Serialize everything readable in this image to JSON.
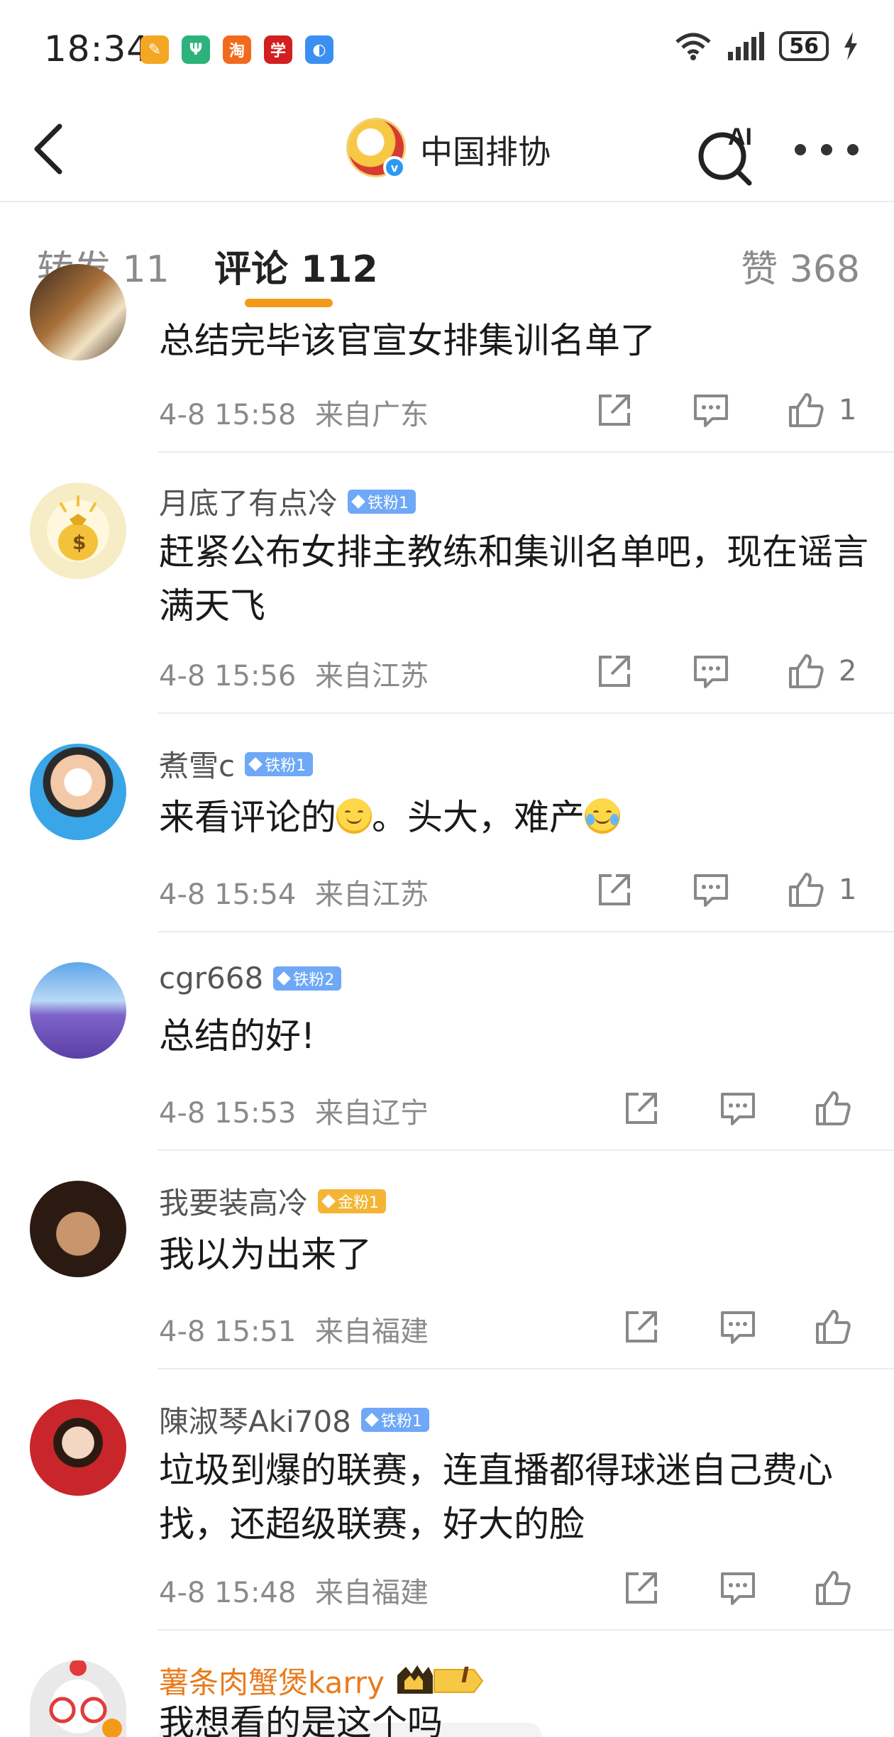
{
  "status_bar": {
    "time": "18:34",
    "apps": [
      {
        "icon": "notes-app-icon",
        "label": "✎",
        "color": "#f5a623"
      },
      {
        "icon": "ecology-app-icon",
        "label": "Ψ",
        "color": "#2cb27a"
      },
      {
        "icon": "taobao-app-icon",
        "label": "淘",
        "color": "#f26b1d"
      },
      {
        "icon": "xuexi-app-icon",
        "label": "学",
        "color": "#d21f1f"
      },
      {
        "icon": "browser-app-icon",
        "label": "◐",
        "color": "#3b8ff0"
      }
    ],
    "battery": "56"
  },
  "header": {
    "title": "中国排协",
    "verified_mark": "v"
  },
  "tabs": {
    "repost": "转发 11",
    "comments": "评论 112",
    "likes": "赞 368"
  },
  "comments": [
    {
      "username": "",
      "text": "总结完毕该官宣女排集训名单了",
      "time": "4-8 15:58",
      "location": "来自广东",
      "like_count": "1"
    },
    {
      "username": "月底了有点冷",
      "badge": "铁粉1",
      "text": "赶紧公布女排主教练和集训名单吧，现在谣言满天飞",
      "time": "4-8 15:56",
      "location": "来自江苏",
      "like_count": "2"
    },
    {
      "username": "煮雪c",
      "badge": "铁粉1",
      "text_a": "来看评论的",
      "text_b": "。头大，难产",
      "time": "4-8 15:54",
      "location": "来自江苏",
      "like_count": "1"
    },
    {
      "username": "cgr668",
      "badge": "铁粉2",
      "text": "总结的好!",
      "time": "4-8 15:53",
      "location": "来自辽宁",
      "like_count": ""
    },
    {
      "username": "我要装高冷",
      "badge": "金粉1",
      "text": "我以为出来了",
      "time": "4-8 15:51",
      "location": "来自福建",
      "like_count": ""
    },
    {
      "username": "陳淑琴Aki708",
      "badge": "铁粉1",
      "text": "垃圾到爆的联赛，连直播都得球迷自己费心找，还超级联赛，好大的脸",
      "time": "4-8 15:48",
      "location": "来自福建",
      "like_count": ""
    },
    {
      "username": "薯条肉蟹煲karry",
      "badge": "I",
      "text": "我想看的是这个吗"
    }
  ],
  "colors": {
    "accent": "#f39b19",
    "fan_badge_blue": "#6ea8f6",
    "fan_badge_gold": "#f3b533",
    "vip_name": "#e87c1e"
  }
}
